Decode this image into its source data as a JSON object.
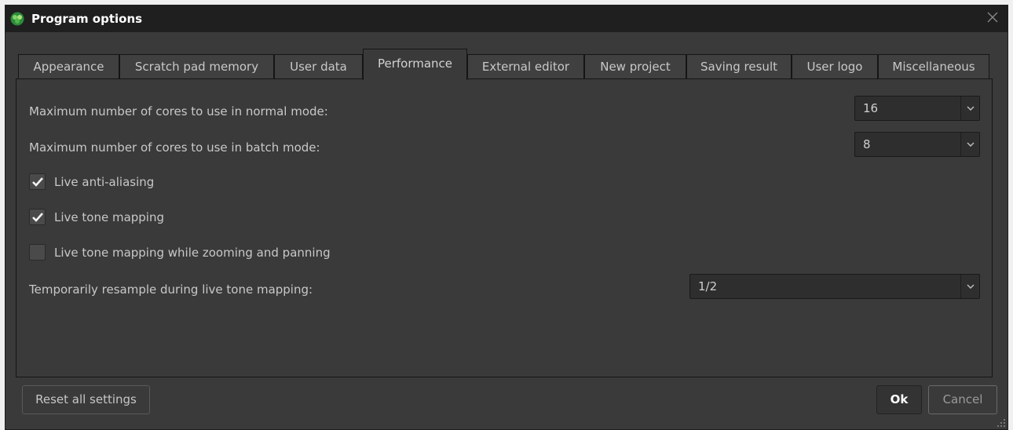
{
  "window": {
    "title": "Program options"
  },
  "tabs": [
    {
      "label": "Appearance"
    },
    {
      "label": "Scratch pad memory"
    },
    {
      "label": "User data"
    },
    {
      "label": "Performance"
    },
    {
      "label": "External editor"
    },
    {
      "label": "New project"
    },
    {
      "label": "Saving result"
    },
    {
      "label": "User logo"
    },
    {
      "label": "Miscellaneous"
    }
  ],
  "active_tab": "Performance",
  "settings": {
    "cores_normal": {
      "label": "Maximum number of cores to use in normal mode:",
      "value": "16"
    },
    "cores_batch": {
      "label": "Maximum number of cores to use in batch mode:",
      "value": "8"
    },
    "live_antialiasing": {
      "label": "Live anti-aliasing",
      "checked": true
    },
    "live_tone_mapping": {
      "label": "Live tone mapping",
      "checked": true
    },
    "live_tone_mapping_zoom": {
      "label": "Live tone mapping while zooming and panning",
      "checked": false
    },
    "resample": {
      "label": "Temporarily resample during live tone mapping:",
      "value": "1/2"
    }
  },
  "footer": {
    "reset_label": "Reset all settings",
    "ok_label": "Ok",
    "cancel_label": "Cancel"
  },
  "icons": {
    "app": "app-logo-icon",
    "close": "close-icon",
    "dropdown": "chevron-down-icon",
    "check": "checkmark-icon",
    "resize": "resize-grip-icon"
  },
  "colors": {
    "background": "#3a3a3a",
    "titlebar": "#1f1f1f",
    "text": "#c8c8c8",
    "field": "#2e2e2e"
  }
}
